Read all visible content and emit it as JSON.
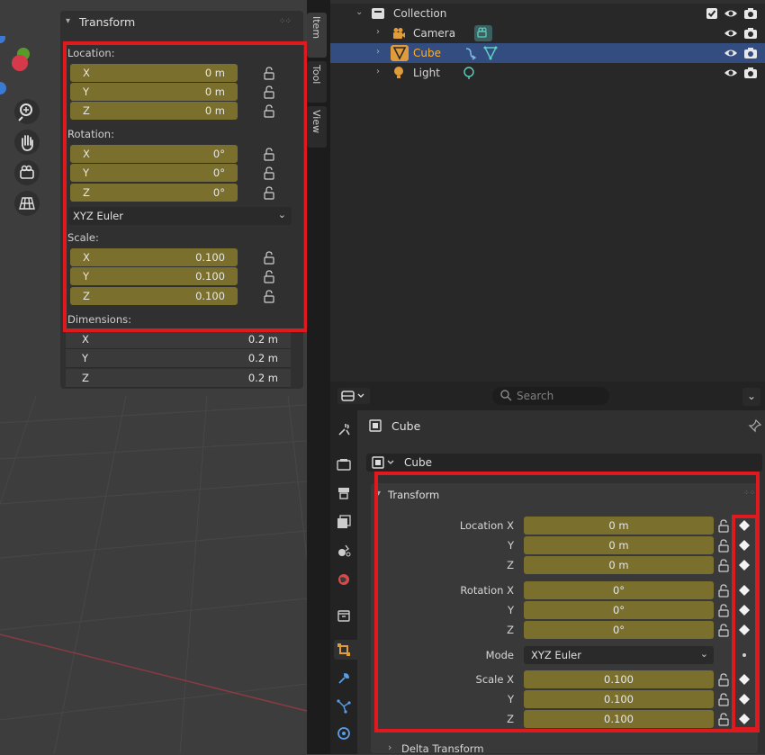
{
  "viewport": {
    "nav_icons": [
      "zoom-icon",
      "hand-pan-icon",
      "camera-view-icon",
      "grid-perspective-icon"
    ],
    "n_panel": {
      "title": "Transform",
      "location_label": "Location:",
      "location": [
        {
          "axis": "X",
          "value": "0 m"
        },
        {
          "axis": "Y",
          "value": "0 m"
        },
        {
          "axis": "Z",
          "value": "0 m"
        }
      ],
      "rotation_label": "Rotation:",
      "rotation": [
        {
          "axis": "X",
          "value": "0°"
        },
        {
          "axis": "Y",
          "value": "0°"
        },
        {
          "axis": "Z",
          "value": "0°"
        }
      ],
      "rotation_mode": "XYZ Euler",
      "scale_label": "Scale:",
      "scale": [
        {
          "axis": "X",
          "value": "0.100"
        },
        {
          "axis": "Y",
          "value": "0.100"
        },
        {
          "axis": "Z",
          "value": "0.100"
        }
      ],
      "dimensions_label": "Dimensions:",
      "dimensions": [
        {
          "axis": "X",
          "value": "0.2 m"
        },
        {
          "axis": "Y",
          "value": "0.2 m"
        },
        {
          "axis": "Z",
          "value": "0.2 m"
        }
      ]
    },
    "side_tabs": [
      "Item",
      "Tool",
      "View"
    ]
  },
  "outliner": {
    "collection": "Collection",
    "items": [
      {
        "name": "Camera",
        "icon": "camera-icon"
      },
      {
        "name": "Cube",
        "icon": "mesh-icon",
        "selected": true
      },
      {
        "name": "Light",
        "icon": "light-icon"
      }
    ]
  },
  "properties": {
    "search_placeholder": "Search",
    "object_name": "Cube",
    "object_field": "Cube",
    "panel_title": "Transform",
    "location_label": "Location X",
    "location": [
      "0 m",
      "0 m",
      "0 m"
    ],
    "rotation_label": "Rotation X",
    "rotation": [
      "0°",
      "0°",
      "0°"
    ],
    "mode_label": "Mode",
    "mode_value": "XYZ Euler",
    "scale_label": "Scale X",
    "scale": [
      "0.100",
      "0.100",
      "0.100"
    ],
    "axis_y": "Y",
    "axis_z": "Z",
    "collapsed_panel": "Delta Transform"
  },
  "colors": {
    "highlight": "#e0191f",
    "field_animated": "#7a6f2c",
    "selected_row": "#334d80",
    "active_object_text": "#ffaf29"
  }
}
